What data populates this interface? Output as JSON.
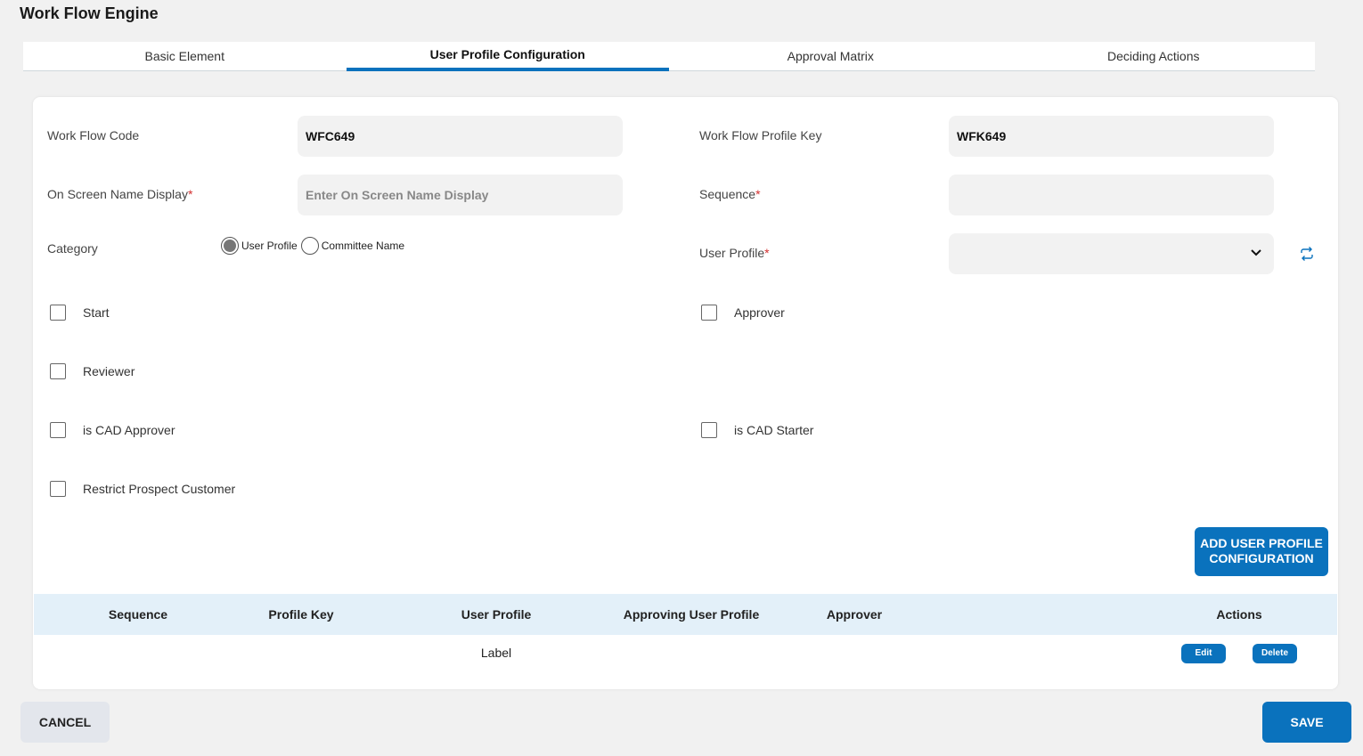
{
  "app": {
    "title": "Work Flow Engine"
  },
  "tabs": [
    {
      "label": "Basic Element"
    },
    {
      "label": "User Profile Configuration",
      "active": true
    },
    {
      "label": "Approval Matrix"
    },
    {
      "label": "Deciding Actions"
    }
  ],
  "form": {
    "workflow_code": {
      "label": "Work Flow Code",
      "value": "WFC649"
    },
    "workflow_profile_key": {
      "label": "Work Flow Profile Key",
      "value": "WFK649"
    },
    "on_screen_name": {
      "label": "On Screen Name Display",
      "required_mark": "*",
      "value": "",
      "placeholder": "Enter On Screen Name Display"
    },
    "sequence": {
      "label": "Sequence",
      "required_mark": "*",
      "value": ""
    },
    "category": {
      "label": "Category",
      "options": [
        "User Profile",
        "Committee Name"
      ],
      "selected": "User Profile"
    },
    "user_profile": {
      "label": "User Profile",
      "required_mark": "*",
      "value": ""
    },
    "checkboxes": {
      "start": "Start",
      "approver": "Approver",
      "reviewer": "Reviewer",
      "is_cad_approver": "is CAD Approver",
      "is_cad_starter": "is CAD Starter",
      "restrict_prospect": "Restrict Prospect Customer"
    },
    "add_button_line1": "ADD USER PROFILE",
    "add_button_line2": "CONFIGURATION"
  },
  "table": {
    "headers": [
      "Sequence",
      "Profile Key",
      "User Profile",
      "Approving User Profile",
      "Approver",
      "Actions"
    ],
    "rows": [
      {
        "user_profile": "Label",
        "edit_label": "Edit",
        "delete_label": "Delete"
      }
    ]
  },
  "footer": {
    "cancel_label": "CANCEL",
    "save_label": "SAVE"
  },
  "colors": {
    "accent": "#0a72bd",
    "table_header_bg": "#e3f0f9",
    "required": "#d32f2f"
  }
}
